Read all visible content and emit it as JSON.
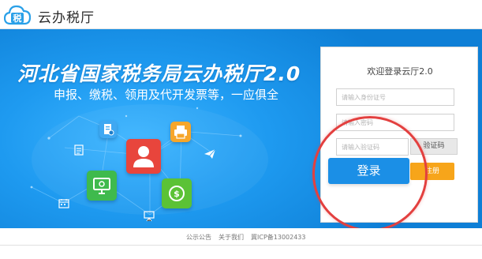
{
  "header": {
    "app_name": "云办税厅",
    "logo_glyph": "税",
    "logo_color": "#2aa0e8"
  },
  "banner": {
    "title": "河北省国家税务局云办税厅2.0",
    "subtitle": "申报、缴税、领用及代开发票等，一应俱全",
    "icons": [
      "invoice-icon",
      "print-icon",
      "user-icon",
      "paper-plane-icon",
      "document-icon",
      "monitor-icon",
      "coin-icon",
      "calendar-icon",
      "presentation-icon"
    ]
  },
  "login": {
    "title": "欢迎登录云厅2.0",
    "id_placeholder": "请输入身份证号",
    "password_placeholder": "请输入密码",
    "captcha_placeholder": "请输入验证码",
    "captcha_button": "验证码",
    "login_button": "登录",
    "register_button": "注册"
  },
  "footer": {
    "notice": "公示公告",
    "about": "关于我们",
    "icp": "冀ICP备13002433"
  },
  "colors": {
    "banner": "#1e9af0",
    "login_button": "#1b8fe6",
    "register_button": "#f7a51a",
    "highlight": "#e3403f"
  }
}
